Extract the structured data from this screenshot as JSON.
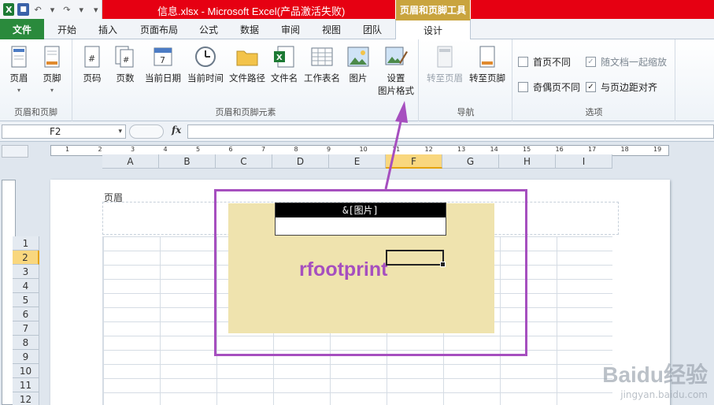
{
  "window": {
    "title": "信息.xlsx  -  Microsoft Excel(产品激活失败)",
    "context_tab_header": "页眉和页脚工具"
  },
  "tabs": [
    {
      "label": "文件"
    },
    {
      "label": "开始"
    },
    {
      "label": "插入"
    },
    {
      "label": "页面布局"
    },
    {
      "label": "公式"
    },
    {
      "label": "数据"
    },
    {
      "label": "审阅"
    },
    {
      "label": "视图"
    },
    {
      "label": "团队"
    },
    {
      "label": "设计"
    }
  ],
  "ribbon": {
    "group1": {
      "label": "页眉和页脚",
      "buttons": [
        {
          "label": "页眉"
        },
        {
          "label": "页脚"
        }
      ]
    },
    "group2": {
      "label": "页眉和页脚元素",
      "buttons": [
        {
          "label": "页码"
        },
        {
          "label": "页数"
        },
        {
          "label": "当前日期"
        },
        {
          "label": "当前时间"
        },
        {
          "label": "文件路径"
        },
        {
          "label": "文件名"
        },
        {
          "label": "工作表名"
        },
        {
          "label": "图片"
        },
        {
          "label": "设置",
          "label2": "图片格式"
        }
      ]
    },
    "group3": {
      "label": "导航",
      "buttons": [
        {
          "label": "转至页眉"
        },
        {
          "label": "转至页脚"
        }
      ]
    },
    "group4": {
      "label": "选项",
      "options": [
        {
          "label": "首页不同",
          "checked": false
        },
        {
          "label": "奇偶页不同",
          "checked": false
        },
        {
          "label": "随文档一起缩放",
          "checked": true
        },
        {
          "label": "与页边距对齐",
          "checked": true
        }
      ]
    }
  },
  "formula_bar": {
    "name_box": "F2",
    "fx": "fx",
    "content": ""
  },
  "ruler": {
    "numbers": [
      "1",
      "2",
      "3",
      "4",
      "5",
      "6",
      "7",
      "8",
      "9",
      "10",
      "11",
      "12",
      "13",
      "14",
      "15",
      "16",
      "17",
      "18",
      "19"
    ]
  },
  "sheet": {
    "columns": [
      "A",
      "B",
      "C",
      "D",
      "E",
      "F",
      "G",
      "H",
      "I"
    ],
    "selected_column": "F",
    "rows": [
      "1",
      "2",
      "3",
      "4",
      "5",
      "6",
      "7",
      "8",
      "9",
      "10",
      "11",
      "12"
    ],
    "selected_row": "2",
    "header_label": "页眉",
    "header_field_text": "&[图片]",
    "watermark_text": "rfootprint"
  },
  "overlay": {
    "highlight_color": "#a64fbf",
    "brand_watermark": "Baidu经验",
    "brand_url": "jingyan.baidu.com"
  },
  "colors": {
    "title_red": "#e60012",
    "file_green": "#2a8a3c",
    "context_gold": "#c9a43e",
    "selected_header": "#f9d77e",
    "image_bg": "#efe3ae"
  }
}
